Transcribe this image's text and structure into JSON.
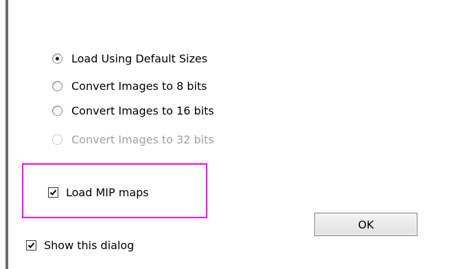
{
  "options": {
    "items": [
      {
        "label": "Load Using Default Sizes",
        "checked": true,
        "enabled": true
      },
      {
        "label": "Convert Images to 8 bits",
        "checked": false,
        "enabled": true
      },
      {
        "label": "Convert Images to 16 bits",
        "checked": false,
        "enabled": true
      },
      {
        "label": "Convert Images to 32 bits",
        "checked": false,
        "enabled": false
      }
    ]
  },
  "load_mip_maps": {
    "label": "Load MIP maps",
    "checked": true
  },
  "show_dialog": {
    "label": "Show this dialog",
    "checked": true
  },
  "ok_button": {
    "label": "OK"
  },
  "colors": {
    "highlight": "#ff00ff",
    "disabled_text": "#a0a0a0",
    "left_bar": "#6d6d6d"
  }
}
